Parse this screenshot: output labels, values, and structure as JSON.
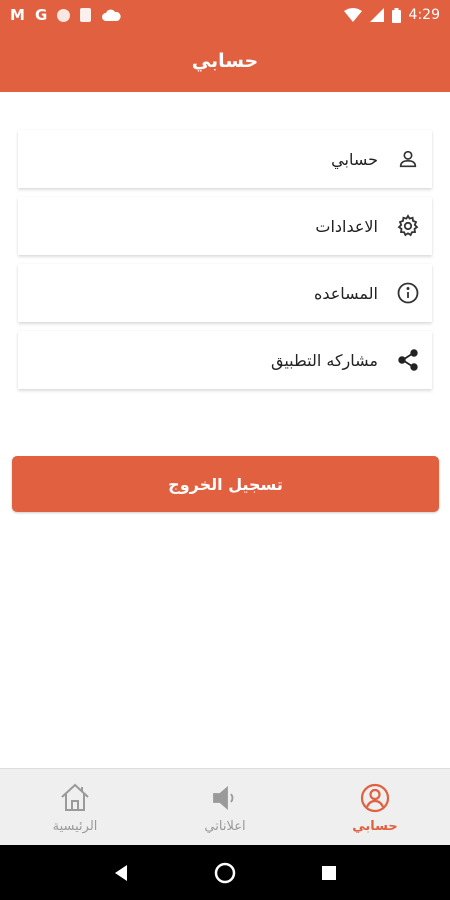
{
  "status_bar": {
    "left_glyphs": [
      "M",
      "G"
    ],
    "time": "4:29"
  },
  "header": {
    "title": "حسابي"
  },
  "menu": {
    "items": [
      {
        "label": "حسابي",
        "icon": "person-icon"
      },
      {
        "label": "الاعدادات",
        "icon": "gear-icon"
      },
      {
        "label": "المساعده",
        "icon": "info-icon"
      },
      {
        "label": "مشاركه التطبيق",
        "icon": "share-icon"
      }
    ]
  },
  "logout": {
    "label": "تسجيل الخروج"
  },
  "bottom_nav": {
    "items": [
      {
        "label": "حسابي",
        "icon": "account-circle-icon",
        "active": true
      },
      {
        "label": "اعلاناتي",
        "icon": "speaker-icon",
        "active": false
      },
      {
        "label": "الرئيسية",
        "icon": "home-icon",
        "active": false
      }
    ]
  },
  "colors": {
    "accent": "#e06040",
    "nav_background": "#efefef",
    "inactive": "#9a9a9a"
  }
}
